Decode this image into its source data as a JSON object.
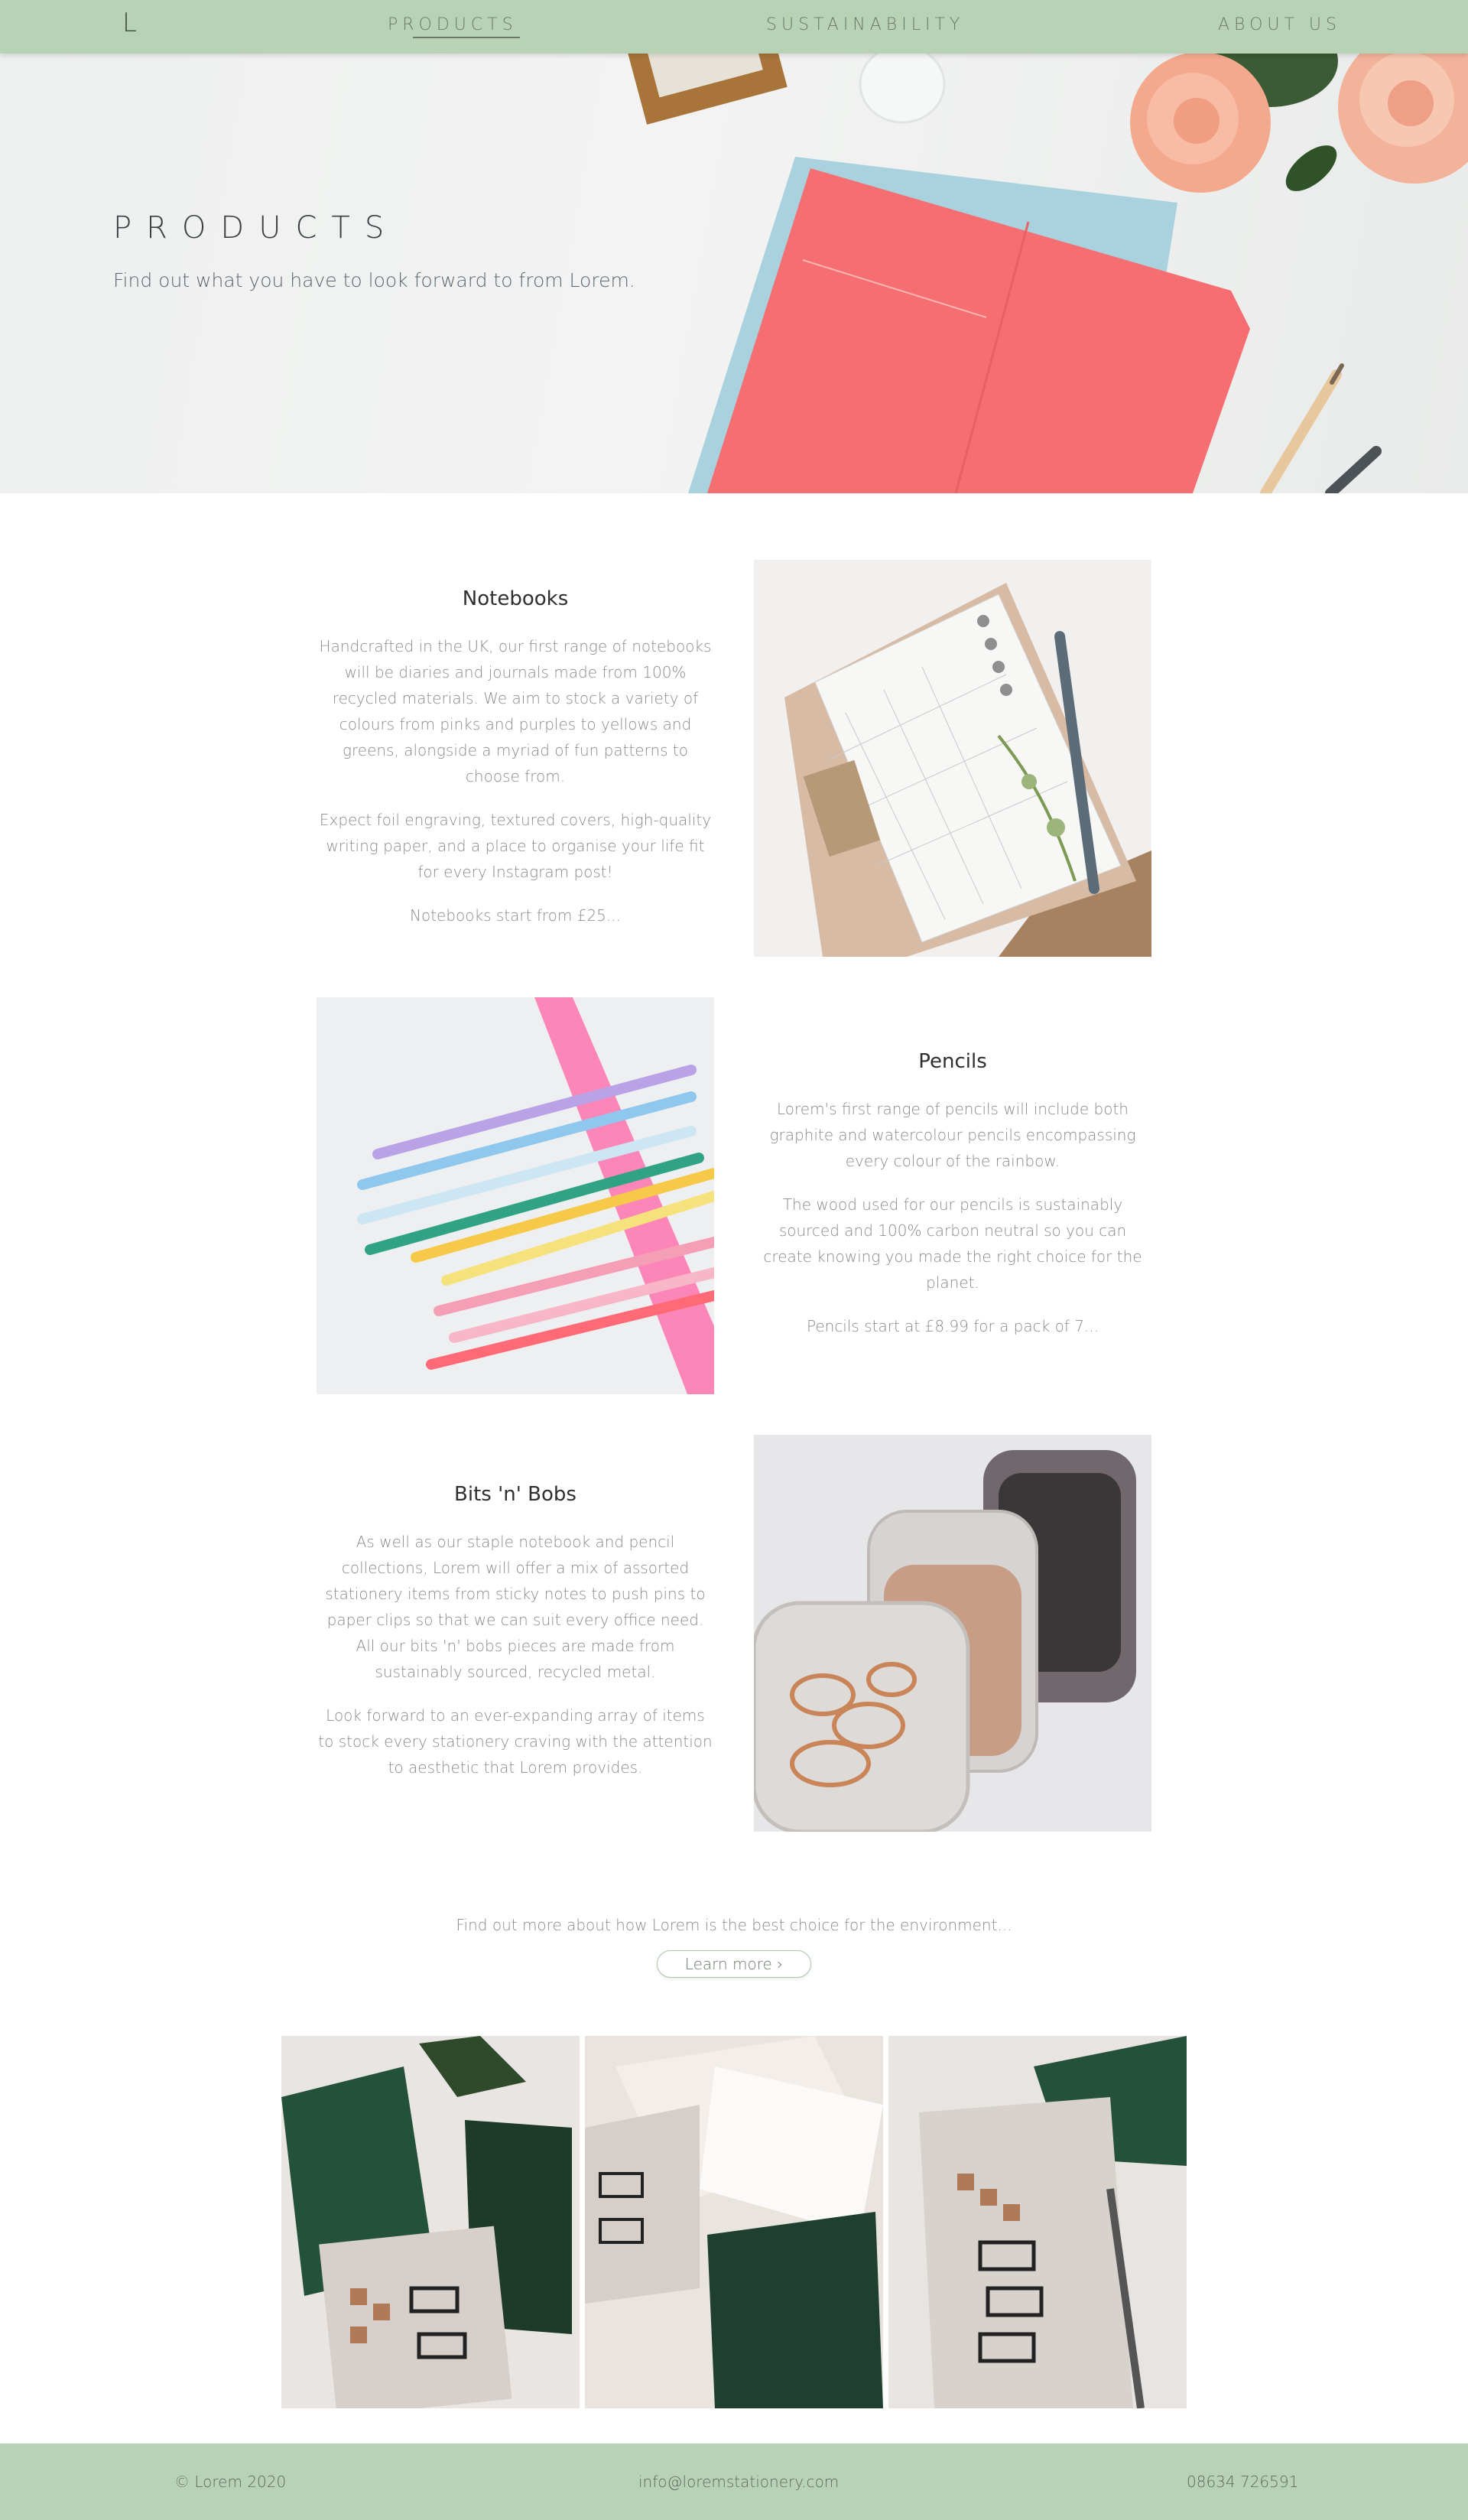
{
  "nav": {
    "logo": "L",
    "links": [
      "PRODUCTS",
      "SUSTAINABILITY",
      "ABOUT US"
    ]
  },
  "hero": {
    "title": "PRODUCTS",
    "subtitle": "Find out what you have to look forward to from Lorem."
  },
  "sections": [
    {
      "heading": "Notebooks",
      "paragraphs": [
        "Handcrafted in the UK, our first range of notebooks will be diaries and journals made from 100% recycled materials. We aim to stock a variety of colours from pinks and purples to yellows and greens, alongside a myriad of fun patterns to choose from.",
        "Expect foil engraving, textured covers, high-quality writing paper, and a place to organise your life fit for every Instagram post!",
        "Notebooks start from £25..."
      ]
    },
    {
      "heading": "Pencils",
      "paragraphs": [
        "Lorem's first range of pencils will include both graphite and watercolour pencils encompassing every colour of the rainbow.",
        "The wood used for our pencils is sustainably sourced and 100% carbon neutral so you can create knowing you made the right choice for the planet.",
        "Pencils start at £8.99 for a pack of 7..."
      ]
    },
    {
      "heading": "Bits 'n' Bobs",
      "paragraphs": [
        "As well as our staple notebook and pencil collections, Lorem will offer a mix of assorted stationery items from sticky notes to push pins to paper clips so that we can suit every office need. All our bits 'n' bobs pieces are made from sustainably sourced, recycled metal.",
        "Look forward to an ever-expanding array of items to stock every stationery craving with the attention to aesthetic that Lorem provides."
      ]
    }
  ],
  "cta": {
    "text": "Find out more about how Lorem is the best choice for the environment...",
    "button": "Learn more ›"
  },
  "footer": {
    "copyright": "© Lorem 2020",
    "email": "info@loremstationery.com",
    "phone": "08634 726591"
  },
  "colors": {
    "accent_green": "#b8d2b6",
    "heading_dark": "#2f2f2f",
    "body_gray": "#8a8a8a"
  }
}
